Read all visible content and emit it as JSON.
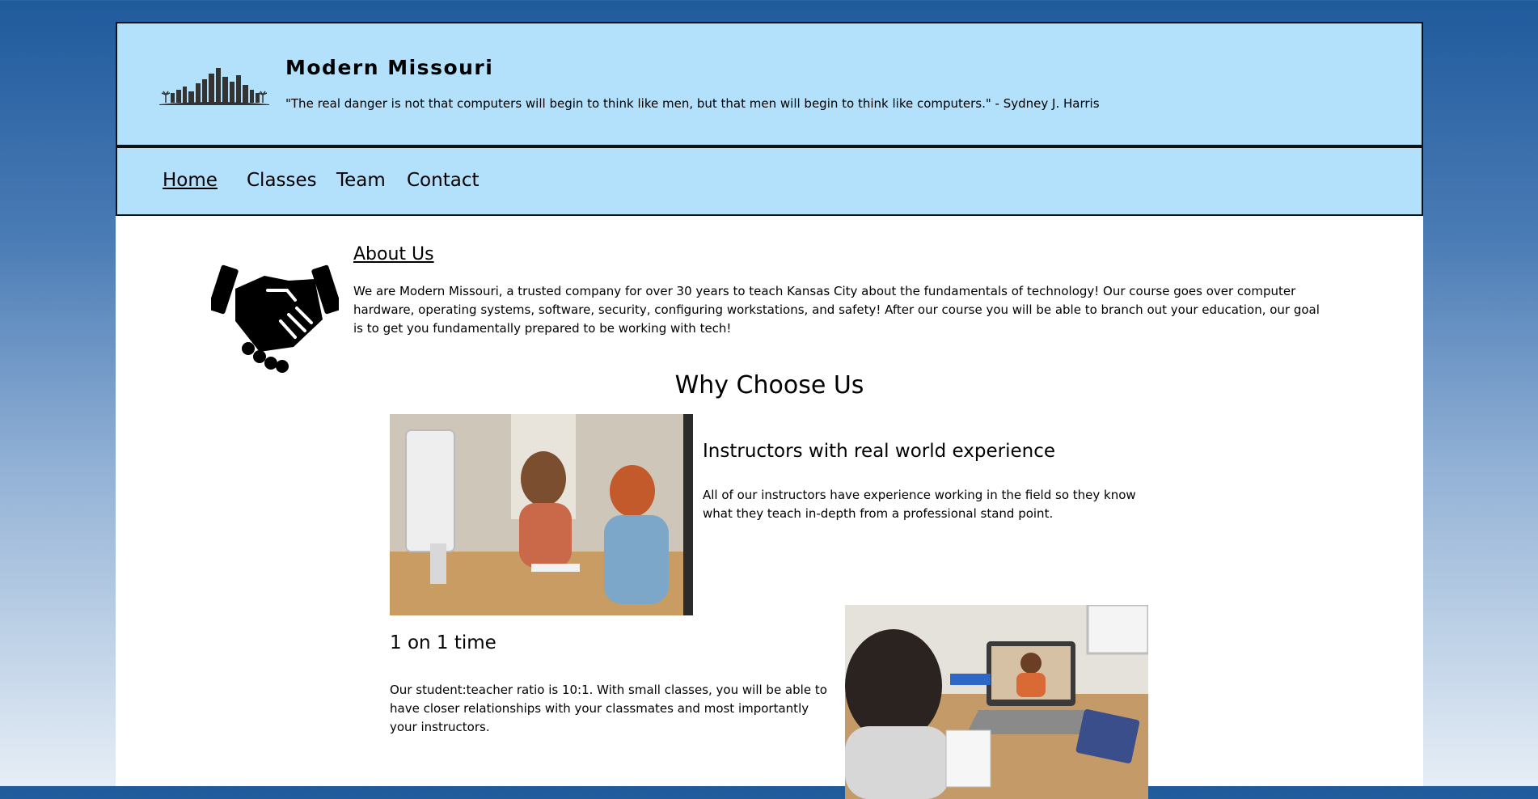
{
  "header": {
    "logo_icon": "city-skyline-icon",
    "title": "Modern Missouri",
    "quote": "\"The real danger is not that computers will begin to think like men, but that men will begin to think like computers.\" - Sydney J. Harris"
  },
  "nav": {
    "items": [
      {
        "label": "Home",
        "active": true
      },
      {
        "label": "Classes",
        "active": false
      },
      {
        "label": "Team",
        "active": false
      },
      {
        "label": "Contact",
        "active": false
      }
    ]
  },
  "about": {
    "icon": "handshake-icon",
    "title": "About Us",
    "text": "We are Modern Missouri, a trusted company for over 30 years to teach Kansas City about the fundamentals of technology! Our course goes over computer hardware, operating systems, software, security, configuring workstations, and safety! After our course you will be able to branch out your education, our goal is to get you fundamentally prepared to be working with tech!"
  },
  "why": {
    "title": "Why Choose Us",
    "features": [
      {
        "title": "Instructors with real world experience",
        "text": "All of our instructors have experience working in the field so they know what they teach in-depth from a professional stand point."
      },
      {
        "title": "1 on 1 time",
        "text": "Our student:teacher ratio is 10:1. With small classes, you will be able to have closer relationships with your classmates and most importantly your instructors."
      }
    ]
  },
  "colors": {
    "header_bg": "#b3e1fb",
    "page_bg": "#ffffff",
    "gradient_top": "#1f5a9c",
    "gradient_bottom": "#e6eef6"
  }
}
